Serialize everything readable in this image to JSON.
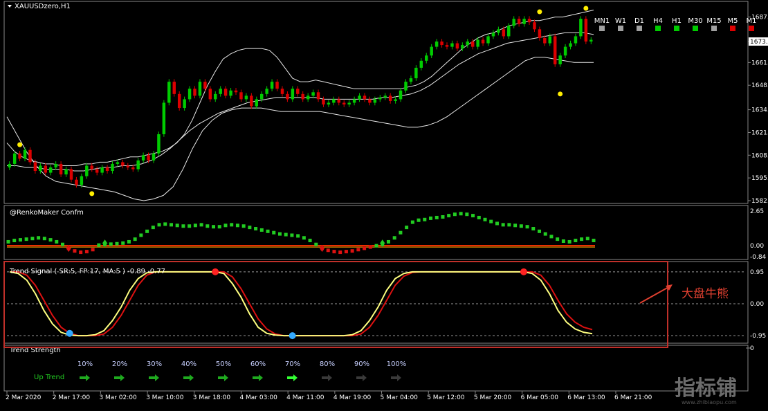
{
  "symbol_title": "XAUUSDzero,H1",
  "renko_title": "@RenkoMaker Confm",
  "trend_signal_title": "Trend Signal ( SR:5, FP:17, MA:5 ) -0.89 -0.77",
  "trend_strength_title": "Trend Strength",
  "annotation": "大盘牛熊",
  "watermark": "指标铺",
  "watermark_url": "www.zhibiaopu.com",
  "timeframes": [
    {
      "label": "MN1",
      "color": "#a0a0a0"
    },
    {
      "label": "W1",
      "color": "#a0a0a0"
    },
    {
      "label": "D1",
      "color": "#a0a0a0"
    },
    {
      "label": "H4",
      "color": "#00cc00"
    },
    {
      "label": "H1",
      "color": "#00cc00"
    },
    {
      "label": "M30",
      "color": "#00cc00"
    },
    {
      "label": "M15",
      "color": "#a0a0a0"
    },
    {
      "label": "M5",
      "color": "#dd0000"
    },
    {
      "label": "M1",
      "color": "#dd0000"
    }
  ],
  "strength": {
    "row_label": "Up Trend",
    "levels": [
      "10%",
      "20%",
      "30%",
      "40%",
      "50%",
      "60%",
      "70%",
      "80%",
      "90%",
      "100%"
    ],
    "active_count": 7
  },
  "chart_data": [
    {
      "type": "candlestick",
      "title": "XAUUSDzero,H1",
      "y_ticks": [
        "1687.",
        "1673.",
        "1661.",
        "1648.",
        "1634.",
        "1621.",
        "1608.",
        "1595.",
        "1582."
      ],
      "current_price": "1673.",
      "ylim": [
        1582,
        1692
      ],
      "x_ticks": [
        "2 Mar 2020",
        "2 Mar 17:00",
        "3 Mar 02:00",
        "3 Mar 10:00",
        "3 Mar 18:00",
        "4 Mar 03:00",
        "4 Mar 11:00",
        "4 Mar 19:00",
        "5 Mar 04:00",
        "5 Mar 12:00",
        "5 Mar 20:00",
        "6 Mar 05:00",
        "6 Mar 13:00",
        "6 Mar 21:00"
      ],
      "close": [
        1603,
        1609,
        1606,
        1611,
        1604,
        1599,
        1602,
        1598,
        1601,
        1603,
        1597,
        1600,
        1594,
        1591,
        1596,
        1602,
        1600,
        1598,
        1601,
        1599,
        1603,
        1604,
        1602,
        1601,
        1600,
        1605,
        1608,
        1605,
        1609,
        1620,
        1638,
        1650,
        1643,
        1635,
        1640,
        1646,
        1642,
        1650,
        1646,
        1640,
        1643,
        1646,
        1642,
        1645,
        1644,
        1640,
        1642,
        1636,
        1640,
        1643,
        1646,
        1650,
        1646,
        1643,
        1640,
        1646,
        1643,
        1640,
        1642,
        1644,
        1640,
        1637,
        1638,
        1640,
        1638,
        1637,
        1638,
        1640,
        1642,
        1640,
        1638,
        1640,
        1641,
        1642,
        1639,
        1640,
        1645,
        1650,
        1652,
        1658,
        1662,
        1665,
        1670,
        1673,
        1671,
        1670,
        1672,
        1669,
        1671,
        1673,
        1670,
        1674,
        1672,
        1676,
        1678,
        1680,
        1676,
        1682,
        1686,
        1683,
        1686,
        1684,
        1680,
        1675,
        1672,
        1676,
        1660,
        1665,
        1670,
        1672,
        1676,
        1686,
        1673,
        1674
      ],
      "bb_upper": [
        1615,
        1610,
        1607,
        1605,
        1604,
        1603,
        1603,
        1602,
        1602,
        1602,
        1603,
        1603,
        1604,
        1604,
        1605,
        1606,
        1607,
        1607,
        1608,
        1609,
        1610,
        1612,
        1615,
        1620,
        1628,
        1638,
        1648,
        1656,
        1663,
        1666,
        1668,
        1669,
        1669,
        1669,
        1668,
        1664,
        1658,
        1652,
        1650,
        1650,
        1651,
        1650,
        1649,
        1648,
        1647,
        1646,
        1646,
        1646,
        1646,
        1646,
        1646,
        1646,
        1647,
        1648,
        1650,
        1653,
        1657,
        1661,
        1665,
        1669,
        1672,
        1675,
        1677,
        1678,
        1680,
        1682,
        1683,
        1684,
        1685,
        1685,
        1686,
        1687,
        1687,
        1688,
        1689,
        1690,
        1691
      ],
      "bb_middle": [
        1602,
        1602,
        1601,
        1601,
        1600,
        1600,
        1600,
        1599,
        1599,
        1600,
        1601,
        1601,
        1602,
        1602,
        1603,
        1605,
        1608,
        1612,
        1617,
        1622,
        1626,
        1629,
        1632,
        1634,
        1636,
        1638,
        1639,
        1640,
        1641,
        1641,
        1641,
        1641,
        1641,
        1640,
        1640,
        1640,
        1640,
        1640,
        1640,
        1641,
        1641,
        1642,
        1643,
        1645,
        1648,
        1652,
        1656,
        1660,
        1663,
        1666,
        1668,
        1670,
        1672,
        1673,
        1674,
        1675,
        1676,
        1677,
        1678,
        1678,
        1678,
        1677
      ],
      "bb_lower": [
        1630,
        1620,
        1610,
        1602,
        1596,
        1593,
        1592,
        1591,
        1590,
        1589,
        1588,
        1587,
        1585,
        1583,
        1582,
        1583,
        1585,
        1590,
        1600,
        1612,
        1622,
        1628,
        1632,
        1634,
        1635,
        1635,
        1635,
        1634,
        1633,
        1633,
        1633,
        1633,
        1633,
        1632,
        1631,
        1630,
        1629,
        1628,
        1627,
        1626,
        1625,
        1624,
        1624,
        1625,
        1627,
        1630,
        1634,
        1638,
        1642,
        1646,
        1650,
        1654,
        1658,
        1662,
        1664,
        1664,
        1663,
        1662,
        1661,
        1661,
        1661
      ],
      "signal_markers": [
        {
          "index": 2,
          "kind": "high",
          "price": 1614
        },
        {
          "index": 16,
          "kind": "low",
          "price": 1586
        },
        {
          "index": 103,
          "kind": "high",
          "price": 1690
        },
        {
          "index": 107,
          "kind": "low",
          "price": 1643
        },
        {
          "index": 112,
          "kind": "high",
          "price": 1692
        }
      ]
    },
    {
      "type": "scatter",
      "title": "@RenkoMaker Confm",
      "y_ticks": [
        "2.65",
        "0.00",
        "-0.84"
      ],
      "ylim": [
        -0.84,
        2.65
      ],
      "values": [
        0.3,
        0.4,
        0.45,
        0.5,
        0.55,
        0.6,
        0.55,
        0.45,
        0.3,
        0.1,
        -0.2,
        -0.4,
        -0.5,
        -0.45,
        -0.3,
        0.05,
        0.1,
        0.12,
        0.15,
        0.2,
        0.3,
        0.5,
        0.8,
        1.1,
        1.4,
        1.6,
        1.65,
        1.6,
        1.55,
        1.5,
        1.5,
        1.55,
        1.6,
        1.5,
        1.45,
        1.45,
        1.55,
        1.6,
        1.55,
        1.5,
        1.4,
        1.3,
        1.2,
        1.1,
        1.0,
        0.9,
        0.85,
        0.8,
        0.75,
        0.6,
        0.4,
        0.1,
        -0.2,
        -0.35,
        -0.45,
        -0.5,
        -0.45,
        -0.4,
        -0.3,
        -0.2,
        -0.1,
        0.0,
        0.1,
        0.3,
        0.6,
        1.0,
        1.4,
        1.8,
        1.95,
        2.0,
        2.1,
        2.15,
        2.2,
        2.3,
        2.4,
        2.45,
        2.4,
        2.3,
        2.15,
        2.0,
        1.85,
        1.7,
        1.6,
        1.6,
        1.55,
        1.5,
        1.45,
        1.3,
        1.1,
        0.9,
        0.7,
        0.5,
        0.35,
        0.3,
        0.4,
        0.5,
        0.55,
        0.4
      ],
      "zero_line_color": "#ff3300",
      "arrows": [
        {
          "index": 10,
          "dir": "down"
        },
        {
          "index": 16,
          "dir": "up"
        },
        {
          "index": 52,
          "dir": "down"
        },
        {
          "index": 62,
          "dir": "up"
        }
      ]
    },
    {
      "type": "line",
      "title": "Trend Signal ( SR:5, FP:17, MA:5 ) -0.89 -0.77",
      "y_ticks": [
        "0.95",
        "0.00",
        "-0.95"
      ],
      "ylim": [
        -1.05,
        1.05
      ],
      "series": [
        {
          "color": "#ffff80",
          "values": [
            0.95,
            0.9,
            0.7,
            0.3,
            -0.2,
            -0.6,
            -0.85,
            -0.93,
            -0.95,
            -0.95,
            -0.92,
            -0.8,
            -0.5,
            -0.1,
            0.4,
            0.75,
            0.92,
            0.95,
            0.95,
            0.95,
            0.95,
            0.95,
            0.95,
            0.95,
            0.95,
            0.9,
            0.6,
            0.2,
            -0.3,
            -0.7,
            -0.88,
            -0.93,
            -0.95,
            -0.95,
            -0.95,
            -0.95,
            -0.95,
            -0.95,
            -0.95,
            -0.95,
            -0.92,
            -0.8,
            -0.5,
            -0.1,
            0.4,
            0.75,
            0.9,
            0.95,
            0.95,
            0.95,
            0.95,
            0.95,
            0.95,
            0.95,
            0.95,
            0.95,
            0.95,
            0.95,
            0.95,
            0.95,
            0.95,
            0.9,
            0.7,
            0.3,
            -0.2,
            -0.55,
            -0.75,
            -0.85,
            -0.89
          ]
        },
        {
          "color": "#dd1111",
          "values": [
            0.95,
            0.95,
            0.85,
            0.55,
            0.1,
            -0.35,
            -0.7,
            -0.88,
            -0.95,
            -0.95,
            -0.95,
            -0.9,
            -0.7,
            -0.35,
            0.1,
            0.55,
            0.85,
            0.95,
            0.95,
            0.95,
            0.95,
            0.95,
            0.95,
            0.95,
            0.95,
            0.95,
            0.8,
            0.45,
            0.0,
            -0.45,
            -0.75,
            -0.9,
            -0.95,
            -0.95,
            -0.95,
            -0.95,
            -0.95,
            -0.95,
            -0.95,
            -0.95,
            -0.95,
            -0.9,
            -0.7,
            -0.35,
            0.1,
            0.55,
            0.82,
            0.93,
            0.95,
            0.95,
            0.95,
            0.95,
            0.95,
            0.95,
            0.95,
            0.95,
            0.95,
            0.95,
            0.95,
            0.95,
            0.95,
            0.95,
            0.85,
            0.55,
            0.1,
            -0.3,
            -0.55,
            -0.7,
            -0.77
          ]
        }
      ],
      "markers": [
        {
          "index": 7,
          "kind": "buy",
          "color": "#33aaff"
        },
        {
          "index": 24,
          "kind": "sell",
          "color": "#ff2222"
        },
        {
          "index": 33,
          "kind": "buy",
          "color": "#33aaff"
        },
        {
          "index": 60,
          "kind": "sell",
          "color": "#ff2222"
        }
      ]
    }
  ]
}
